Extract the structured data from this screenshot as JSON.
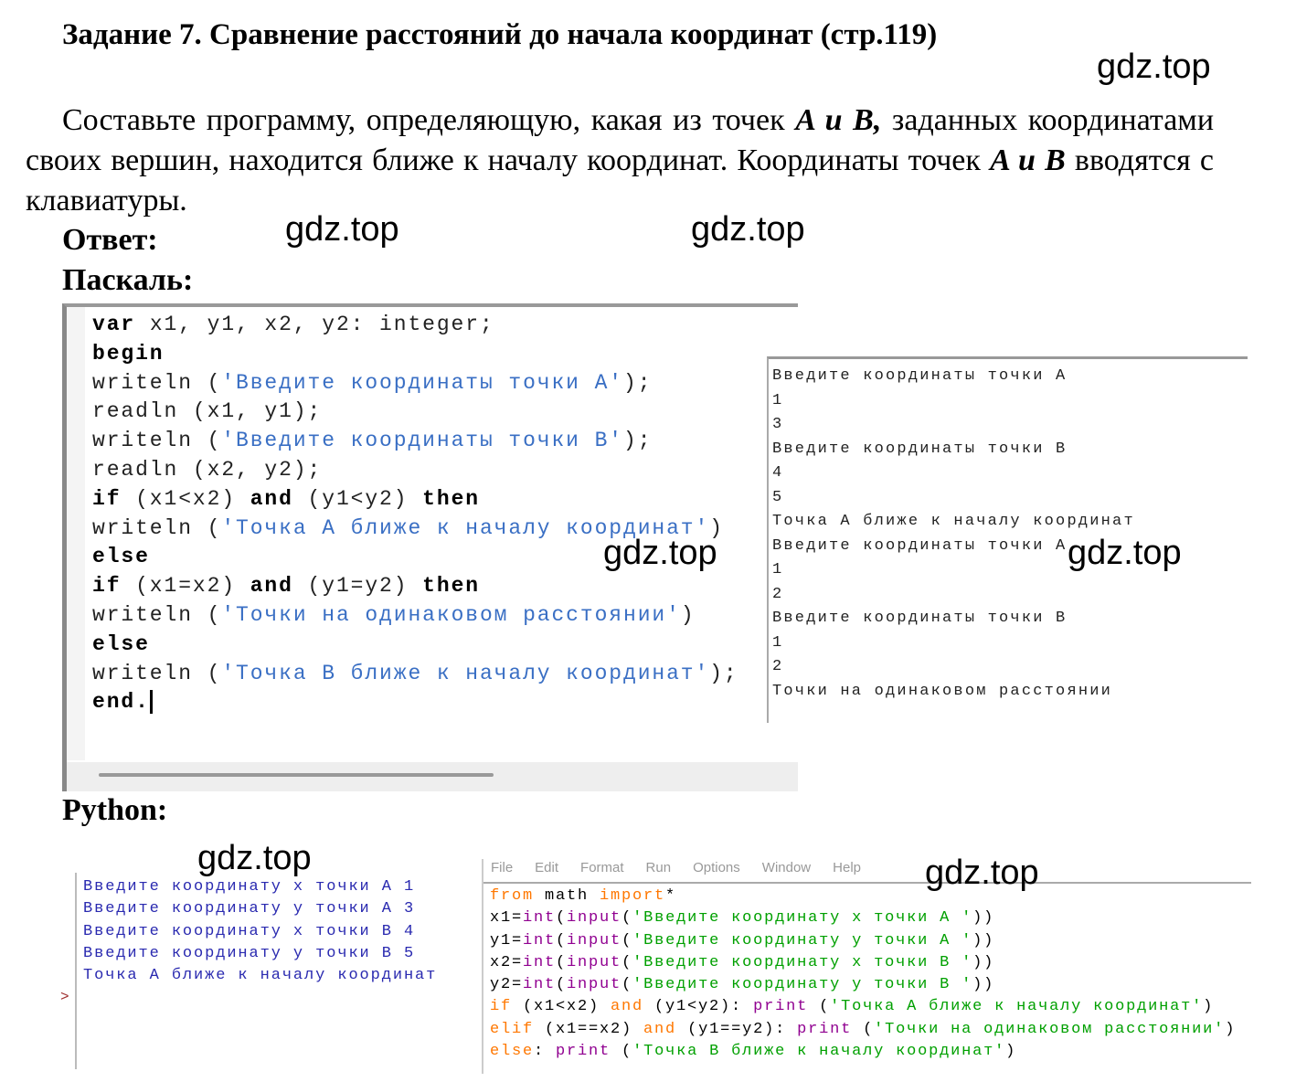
{
  "title": "Задание 7. Сравнение расстояний до начала координат (стр.119)",
  "task": {
    "part1": "Составьте программу, определяющую, какая из точек ",
    "em1": "A и B,",
    "part2": " заданных координатами своих вершин, находится ближе к началу координат. Координаты точек ",
    "em2": "A и B",
    "part3": " вводятся с клавиатуры."
  },
  "answer_label": "Ответ:",
  "pascal_label": "Паскаль:",
  "python_label": "Python:",
  "watermark": "gdz.top",
  "pascal_code": [
    [
      [
        "k",
        "var"
      ],
      [
        "",
        "x1, y1, x2, y2: integer;"
      ]
    ],
    [
      [
        "k",
        "begin"
      ]
    ],
    [
      [
        "",
        "writeln ("
      ],
      [
        "s",
        "'Введите координаты точки A'"
      ],
      [
        "",
        ");"
      ]
    ],
    [
      [
        "",
        "readln (x1, y1);"
      ]
    ],
    [
      [
        "",
        "writeln ("
      ],
      [
        "s",
        "'Введите координаты точки B'"
      ],
      [
        "",
        ");"
      ]
    ],
    [
      [
        "",
        "readln (x2, y2);"
      ]
    ],
    [
      [
        "k",
        "if"
      ],
      [
        "",
        "(x1<x2) "
      ],
      [
        "k",
        "and"
      ],
      [
        "",
        "(y1<y2) "
      ],
      [
        "k",
        "then"
      ]
    ],
    [
      [
        "",
        "writeln ("
      ],
      [
        "s",
        "'Точка A ближе к началу координат'"
      ],
      [
        "",
        ")"
      ]
    ],
    [
      [
        "k",
        "else"
      ]
    ],
    [
      [
        "k",
        "if"
      ],
      [
        "",
        "(x1=x2) "
      ],
      [
        "k",
        "and"
      ],
      [
        "",
        "(y1=y2) "
      ],
      [
        "k",
        "then"
      ]
    ],
    [
      [
        "",
        "writeln ("
      ],
      [
        "s",
        "'Точки на одинаковом расстоянии'"
      ],
      [
        "",
        ")"
      ]
    ],
    [
      [
        "k",
        "else"
      ]
    ],
    [
      [
        "",
        "writeln ("
      ],
      [
        "s",
        "'Точка B ближе к началу координат'"
      ],
      [
        "",
        ");"
      ]
    ],
    [
      [
        "k",
        "end."
      ]
    ]
  ],
  "pascal_output": [
    "Введите координаты точки A",
    "1",
    "3",
    "Введите координаты точки B",
    "4",
    "5",
    "Точка A ближе к началу координат",
    "Введите координаты точки A",
    "1",
    "2",
    "Введите координаты точки B",
    "1",
    "2",
    "Точки на одинаковом расстоянии"
  ],
  "python_output": [
    "Введите координату x точки A 1",
    "Введите координату y точки A 3",
    "Введите координату x точки B 4",
    "Введите координату y точки B 5",
    "Точка A ближе к началу координат"
  ],
  "python_prompt": ">",
  "python_menu": [
    "File",
    "Edit",
    "Format",
    "Run",
    "Options",
    "Window",
    "Help"
  ],
  "python_code": [
    [
      [
        "o",
        "from"
      ],
      [
        "",
        " math "
      ],
      [
        "o",
        "import"
      ],
      [
        "",
        "*"
      ]
    ],
    [
      [
        "",
        "x1="
      ],
      [
        "pu",
        "int"
      ],
      [
        "",
        "("
      ],
      [
        "pu",
        "input"
      ],
      [
        "",
        "("
      ],
      [
        "g",
        "'Введите координату x точки A '"
      ],
      [
        "",
        "))"
      ]
    ],
    [
      [
        "",
        "y1="
      ],
      [
        "pu",
        "int"
      ],
      [
        "",
        "("
      ],
      [
        "pu",
        "input"
      ],
      [
        "",
        "("
      ],
      [
        "g",
        "'Введите координату y точки A '"
      ],
      [
        "",
        "))"
      ]
    ],
    [
      [
        "",
        "x2="
      ],
      [
        "pu",
        "int"
      ],
      [
        "",
        "("
      ],
      [
        "pu",
        "input"
      ],
      [
        "",
        "("
      ],
      [
        "g",
        "'Введите координату x точки B '"
      ],
      [
        "",
        "))"
      ]
    ],
    [
      [
        "",
        "y2="
      ],
      [
        "pu",
        "int"
      ],
      [
        "",
        "("
      ],
      [
        "pu",
        "input"
      ],
      [
        "",
        "("
      ],
      [
        "g",
        "'Введите координату y точки B '"
      ],
      [
        "",
        "))"
      ]
    ],
    [
      [
        "o",
        "if"
      ],
      [
        "",
        " (x1<x2) "
      ],
      [
        "o",
        "and"
      ],
      [
        "",
        " (y1<y2): "
      ],
      [
        "pu",
        "print"
      ],
      [
        "",
        " ("
      ],
      [
        "g",
        "'Точка A ближе к началу координат'"
      ],
      [
        "",
        ")"
      ]
    ],
    [
      [
        "o",
        "elif"
      ],
      [
        "",
        " (x1==x2) "
      ],
      [
        "o",
        "and"
      ],
      [
        "",
        " (y1==y2): "
      ],
      [
        "pu",
        "print"
      ],
      [
        "",
        " ("
      ],
      [
        "g",
        "'Точки на одинаковом расстоянии'"
      ],
      [
        "",
        ")"
      ]
    ],
    [
      [
        "o",
        "else"
      ],
      [
        "",
        ": "
      ],
      [
        "pu",
        "print"
      ],
      [
        "",
        " ("
      ],
      [
        "g",
        "'Точка B ближе к началу координат'"
      ],
      [
        "",
        ")"
      ]
    ]
  ],
  "colors": {
    "pascal_string": "#3a6fc4",
    "py_keyword": "#ff7700",
    "py_builtin": "#900090",
    "py_string": "#00a000",
    "py_output": "#2a2ab0"
  }
}
